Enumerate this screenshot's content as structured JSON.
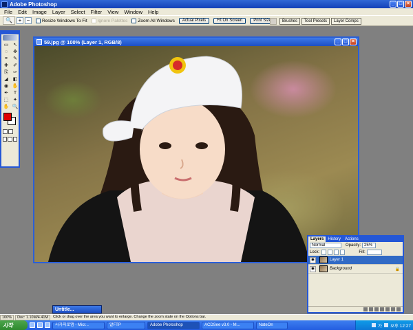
{
  "window": {
    "title": "Adobe Photoshop"
  },
  "menu": [
    "File",
    "Edit",
    "Image",
    "Layer",
    "Select",
    "Filter",
    "View",
    "Window",
    "Help"
  ],
  "options_bar": {
    "tool_icon": "zoom-tool-icon",
    "resize_windows_label": "Resize Windows To Fit",
    "ignore_palettes_label": "Ignore Palettes",
    "zoom_all_windows_label": "Zoom All Windows",
    "actual_pixels_label": "Actual Pixels",
    "fit_on_screen_label": "Fit On Screen",
    "print_size_label": "Print Size"
  },
  "palette_well": {
    "tabs": [
      "Brushes",
      "Tool Presets",
      "Layer Comps"
    ]
  },
  "document": {
    "title": "59.jpg @ 100% (Layer 1, RGB/8)"
  },
  "toolbox": {
    "foreground_color": "#e00000",
    "background_color": "#ffffff",
    "tools": [
      "▭",
      "↖",
      "◌",
      "✥",
      "⌗",
      "✎",
      "✚",
      "✐",
      "⎘",
      "✑",
      "◢",
      "◧",
      "◉",
      "✋",
      "✒",
      "T",
      "⬚",
      "✦",
      "✋",
      "🔍"
    ]
  },
  "layers_panel": {
    "tabs": [
      "Layers",
      "History",
      "Actions"
    ],
    "blend_mode": "Normal",
    "opacity_label": "Opacity:",
    "opacity_value": "25%",
    "lock_label": "Lock:",
    "fill_label": "Fill:",
    "layers": [
      {
        "name": "Layer 1",
        "active": true
      },
      {
        "name": "Background",
        "active": false
      }
    ]
  },
  "minimized_doc": {
    "title": "Untitle..."
  },
  "status_bar": {
    "zoom": "100%",
    "doc": "Doc: 1.10M/4.41M",
    "hint": "Click or drag over the area you want to enlarge. Change the zoom state on the Options bar."
  },
  "taskbar": {
    "start_label": "시작",
    "tasks": [
      {
        "label": "사가지로앱 - Micr...",
        "active": false
      },
      {
        "label": "알FTP",
        "active": false
      },
      {
        "label": "Adobe Photoshop",
        "active": true
      },
      {
        "label": "ACDSee v3.0 - M...",
        "active": false
      },
      {
        "label": "NateOn",
        "active": false
      }
    ],
    "tray_lang": "가",
    "clock": "오후 12:27"
  }
}
